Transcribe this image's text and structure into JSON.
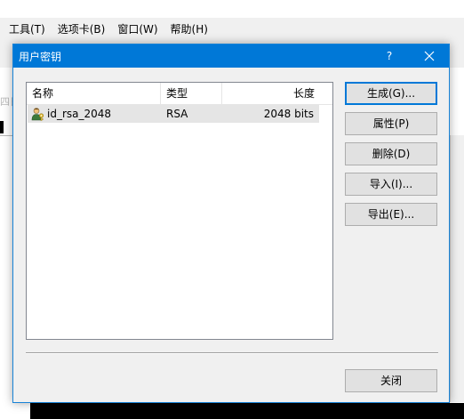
{
  "background_app": {
    "menu": [
      {
        "label": "工具(T)"
      },
      {
        "label": "选项卡(B)"
      },
      {
        "label": "窗口(W)"
      },
      {
        "label": "帮助(H)"
      }
    ],
    "ghost_text": "四日"
  },
  "dialog": {
    "title": "用户密钥",
    "help_label": "?",
    "list": {
      "columns": [
        {
          "label": "名称"
        },
        {
          "label": "类型"
        },
        {
          "label": "长度"
        }
      ],
      "rows": [
        {
          "name": "id_rsa_2048",
          "type": "RSA",
          "length": "2048 bits",
          "icon": "key-user-icon"
        }
      ]
    },
    "buttons": {
      "generate": "生成(G)...",
      "properties": "属性(P)",
      "delete": "删除(D)",
      "import": "导入(I)...",
      "export": "导出(E)...",
      "close": "关闭"
    }
  },
  "colors": {
    "title_bar": "#0078d7",
    "dialog_bg": "#f0f0f0",
    "selected_row": "#e5e5e5"
  }
}
